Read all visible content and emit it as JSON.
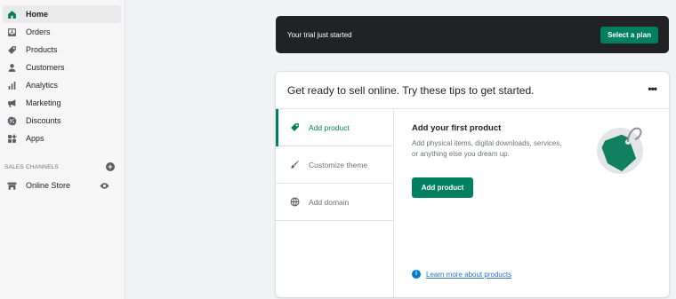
{
  "sidebar": {
    "items": [
      {
        "label": "Home",
        "icon": "home-icon"
      },
      {
        "label": "Orders",
        "icon": "orders-icon"
      },
      {
        "label": "Products",
        "icon": "tag-icon"
      },
      {
        "label": "Customers",
        "icon": "person-icon"
      },
      {
        "label": "Analytics",
        "icon": "bar-chart-icon"
      },
      {
        "label": "Marketing",
        "icon": "megaphone-icon"
      },
      {
        "label": "Discounts",
        "icon": "discount-icon"
      },
      {
        "label": "Apps",
        "icon": "apps-icon"
      }
    ],
    "sales_channels_header": "SALES CHANNELS",
    "online_store": "Online Store"
  },
  "banner": {
    "text": "Your trial just started",
    "button": "Select a plan"
  },
  "setup": {
    "title": "Get ready to sell online. Try these tips to get started.",
    "tabs": [
      {
        "label": "Add product",
        "icon": "tag-icon"
      },
      {
        "label": "Customize theme",
        "icon": "brush-icon"
      },
      {
        "label": "Add domain",
        "icon": "globe-icon"
      }
    ],
    "heading": "Add your first product",
    "description": "Add physical items, digital downloads, services, or anything else you dream up.",
    "button": "Add product",
    "learn_more": "Learn more about products"
  },
  "colors": {
    "accent": "#008060",
    "banner_bg": "#202223",
    "link": "#2c6ecb"
  }
}
